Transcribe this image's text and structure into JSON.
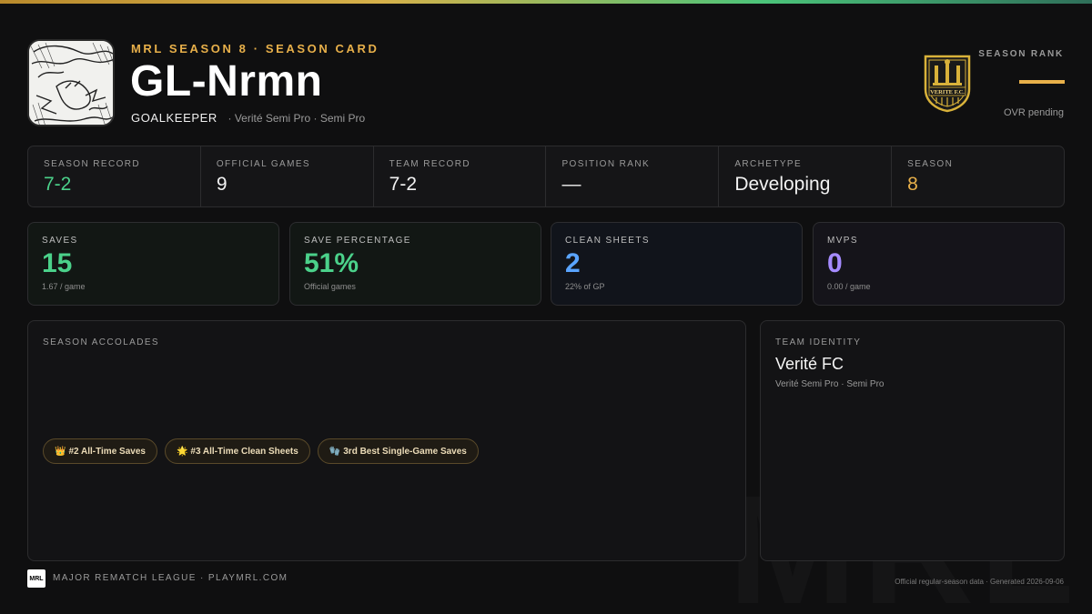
{
  "header": {
    "eyebrow": "MRL SEASON 8 · SEASON CARD",
    "player_name": "GL-Nrmn",
    "position": "GOALKEEPER",
    "team_line": "· Verité Semi Pro · Semi Pro"
  },
  "crest": {
    "text": "VERITE F.C.",
    "icon": "team-crest-icon"
  },
  "rank": {
    "label": "SEASON RANK",
    "value": "—",
    "note": "OVR pending"
  },
  "summary": [
    {
      "label": "SEASON RECORD",
      "value": "7-2",
      "color": "#4bd18a"
    },
    {
      "label": "OFFICIAL GAMES",
      "value": "9",
      "color": "#f2f2f2"
    },
    {
      "label": "TEAM RECORD",
      "value": "7-2",
      "color": "#f2f2f2"
    },
    {
      "label": "POSITION RANK",
      "value": "—",
      "color": "#f2f2f2"
    },
    {
      "label": "ARCHETYPE",
      "value": "Developing",
      "color": "#f2f2f2"
    },
    {
      "label": "SEASON",
      "value": "8",
      "color": "#e8b04a"
    }
  ],
  "stats": [
    {
      "label": "SAVES",
      "value": "15",
      "sub": "1.67 / game",
      "color": "#4bd18a"
    },
    {
      "label": "SAVE PERCENTAGE",
      "value": "51%",
      "sub": "Official games",
      "color": "#4bd18a"
    },
    {
      "label": "CLEAN SHEETS",
      "value": "2",
      "sub": "22% of GP",
      "color": "#5aa4ff"
    },
    {
      "label": "MVPS",
      "value": "0",
      "sub": "0.00 / game",
      "color": "#a58bff"
    }
  ],
  "accolades": {
    "title": "SEASON ACCOLADES",
    "items": [
      {
        "icon": "👑",
        "label": "#2 All-Time Saves"
      },
      {
        "icon": "🌟",
        "label": "#3 All-Time Clean Sheets"
      },
      {
        "icon": "🧤",
        "label": "3rd Best Single-Game Saves"
      }
    ]
  },
  "team_identity": {
    "title": "TEAM IDENTITY",
    "name": "Verité FC",
    "sub": "Verité Semi Pro · Semi Pro"
  },
  "footer": {
    "logo_text": "MRL",
    "left": "MAJOR REMATCH LEAGUE · PLAYMRL.COM",
    "right": "Official regular-season data · Generated 2026-09-06",
    "watermark": "MRL"
  },
  "colors": {
    "accent_gold": "#e8b04a",
    "accent_green": "#4bd18a",
    "accent_blue": "#5aa4ff",
    "accent_purple": "#a58bff"
  }
}
